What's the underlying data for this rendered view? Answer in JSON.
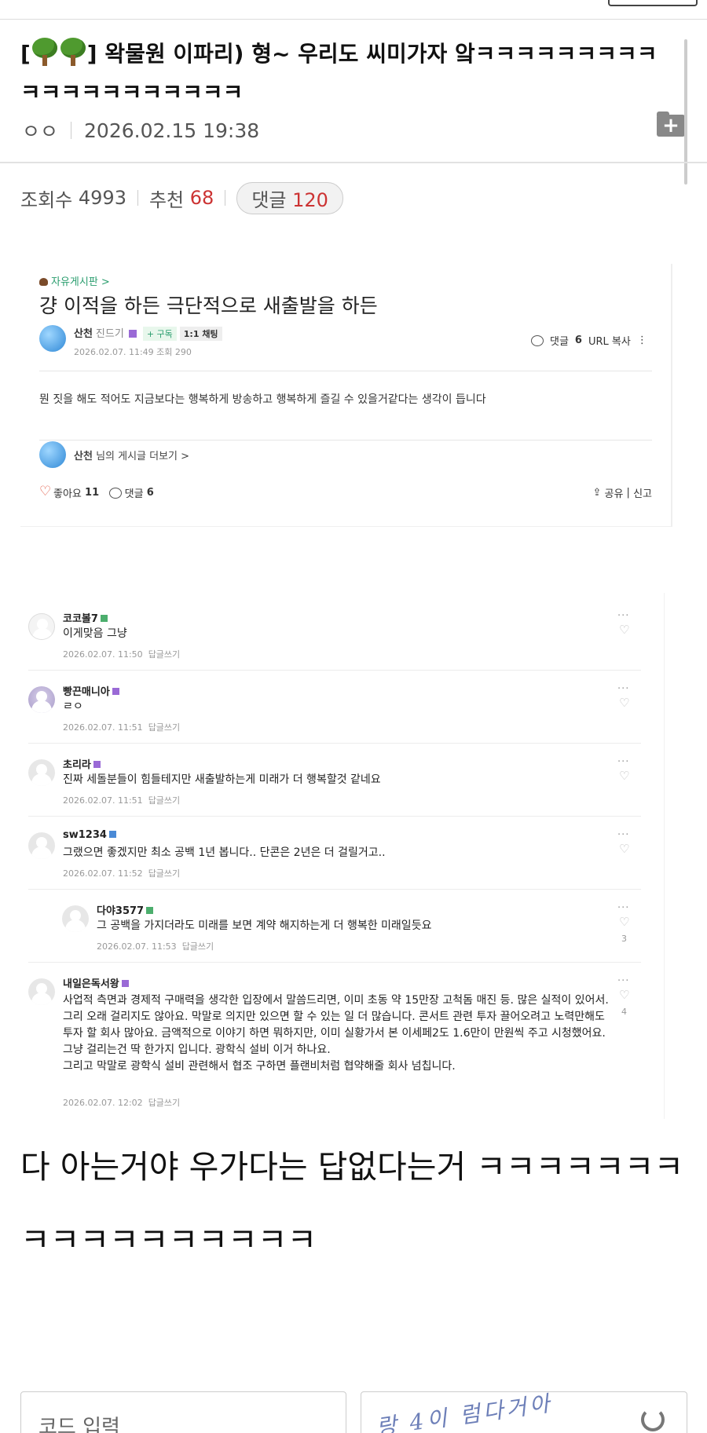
{
  "post": {
    "title": "] 왁물원 이파리) 형~ 우리도 씨미가자 앜ㅋㅋㅋㅋㅋㅋㅋㅋㅋㅋㅋㅋㅋㅋㅋㅋㅋㅋㅋㅋ",
    "title_prefix": "[",
    "author": "ㅇㅇ",
    "datetime": "2026.02.15 19:38",
    "views_label": "조회수",
    "views": "4993",
    "recommend_label": "추천",
    "recommend": "68",
    "comments_label": "댓글",
    "comments": "120",
    "folder_icon": "+"
  },
  "embed_post": {
    "board": "자유게시판 >",
    "title": "걍 이적을 하든 극단적으로 새출발을 하든",
    "author": "산천",
    "level": "진드기",
    "subscribe": "+ 구독",
    "chat": "1:1 채팅",
    "date": "2026.02.07. 11:49  조회 290",
    "comment_label": "댓글",
    "comment_count": "6",
    "url_copy": "URL 복사",
    "body": "뭔 짓을 해도 적어도 지금보다는 행복하게 방송하고 행복하게 즐길 수 있을거같다는 생각이 듭니다",
    "more_author": "산천",
    "more_suffix": "님의 게시글 더보기 >",
    "like_label": "좋아요",
    "like_count": "11",
    "comments_label": "댓글",
    "comments_count": "6",
    "share": "공유",
    "report": "신고"
  },
  "comments": [
    {
      "name": "코코볼7",
      "text": "이게맞음 그냥",
      "date": "2026.02.07. 11:50",
      "reply": "답글쓰기"
    },
    {
      "name": "빵끈매니아",
      "text": "ㄹㅇ",
      "date": "2026.02.07. 11:51",
      "reply": "답글쓰기"
    },
    {
      "name": "초리라",
      "text": "진짜 세돌분들이 힘들테지만 새출발하는게 미래가 더 행복할것 같네요",
      "date": "2026.02.07. 11:51",
      "reply": "답글쓰기"
    },
    {
      "name": "sw1234",
      "text": "그랬으면 좋겠지만 최소 공백 1년 봅니다.. 단콘은 2년은 더 걸릴거고..",
      "date": "2026.02.07. 11:52",
      "reply": "답글쓰기"
    },
    {
      "name": "다야3577",
      "text": "그 공백을 가지더라도 미래를 보면 계약 해지하는게 더 행복한 미래일듯요",
      "date": "2026.02.07. 11:53",
      "reply": "답글쓰기",
      "likes": "3"
    },
    {
      "name": "내일은독서왕",
      "text": "사업적 측면과 경제적 구매력을 생각한 입장에서 말씀드리면, 이미 초동 약 15만장 고척돔 매진 등. 많은 실적이 있어서. 그리 오래 걸리지도 않아요. 막말로 의지만 있으면 할 수 있는 일 더 많습니다. 콘서트 관련 투자 끌어오려고 노력만해도 투자 할 회사 많아요. 금액적으로 이야기 하면 뭐하지만, 이미 실황가서 본 이세페2도 1.6만이 만원씩 주고 시청했어요.",
      "text2": "그냥 걸리는건 딱 한가지 입니다. 광학식 설비 이거 하나요.",
      "text3": "그리고 막말로 광학식 설비 관련해서 협조 구하면 플랜비처럼 협약해줄 회사 넘칩니다.",
      "date": "2026.02.07. 12:02",
      "reply": "답글쓰기",
      "likes": "4"
    }
  ],
  "bottom_text": "다 아는거야 우가다는 답없다는거 ㅋㅋㅋㅋㅋㅋㅋㅋㅋㅋㅋㅋㅋㅋㅋㅋㅋ",
  "code_input_placeholder": "코드 입력",
  "captcha_text": "랑 4이 럼다거아"
}
